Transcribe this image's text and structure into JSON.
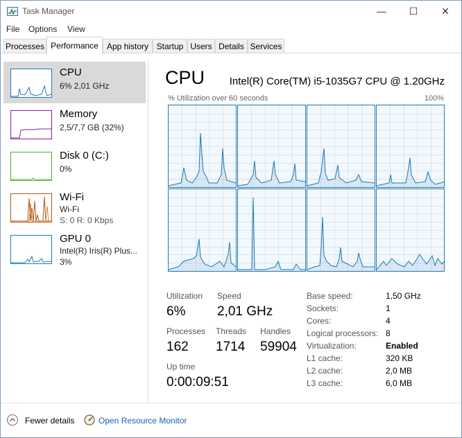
{
  "window": {
    "title": "Task Manager",
    "controls": {
      "minimize": "—",
      "maximize": "☐",
      "close": "✕"
    }
  },
  "menu": [
    "File",
    "Options",
    "View"
  ],
  "tabs": [
    {
      "label": "Processes",
      "active": false
    },
    {
      "label": "Performance",
      "active": true
    },
    {
      "label": "App history",
      "active": false
    },
    {
      "label": "Startup",
      "active": false
    },
    {
      "label": "Users",
      "active": false
    },
    {
      "label": "Details",
      "active": false
    },
    {
      "label": "Services",
      "active": false
    }
  ],
  "resources": [
    {
      "name": "CPU",
      "line1": "6% 2,01 GHz",
      "line2": "",
      "selected": true,
      "color": "#1f77b4"
    },
    {
      "name": "Memory",
      "line1": "2,5/7,7 GB (32%)",
      "line2": "",
      "selected": false,
      "color": "#8b1a9c"
    },
    {
      "name": "Disk 0 (C:)",
      "line1": "0%",
      "line2": "",
      "selected": false,
      "color": "#4caf20"
    },
    {
      "name": "Wi-Fi",
      "line1": "Wi-Fi",
      "line2": "S: 0 R: 0 Kbps",
      "selected": false,
      "color": "#b5530c"
    },
    {
      "name": "GPU 0",
      "line1": "Intel(R) Iris(R) Plus...",
      "line2": "3%",
      "selected": false,
      "color": "#1f77b4"
    }
  ],
  "cpu": {
    "heading": "CPU",
    "model": "Intel(R) Core(TM) i5-1035G7 CPU @ 1.20GHz",
    "graph_label": "% Utilization over 60 seconds",
    "graph_max": "100%",
    "core_count": 8
  },
  "stats": {
    "utilization": {
      "label": "Utilization",
      "value": "6%"
    },
    "speed": {
      "label": "Speed",
      "value": "2,01 GHz"
    },
    "processes": {
      "label": "Processes",
      "value": "162"
    },
    "threads": {
      "label": "Threads",
      "value": "1714"
    },
    "handles": {
      "label": "Handles",
      "value": "59904"
    },
    "uptime": {
      "label": "Up time",
      "value": "0:00:09:51"
    }
  },
  "specs": [
    {
      "label": "Base speed:",
      "value": "1,50 GHz",
      "bold": false
    },
    {
      "label": "Sockets:",
      "value": "1",
      "bold": false
    },
    {
      "label": "Cores:",
      "value": "4",
      "bold": false
    },
    {
      "label": "Logical processors:",
      "value": "8",
      "bold": false
    },
    {
      "label": "Virtualization:",
      "value": "Enabled",
      "bold": true
    },
    {
      "label": "L1 cache:",
      "value": "320 KB",
      "bold": false
    },
    {
      "label": "L2 cache:",
      "value": "2,0 MB",
      "bold": false
    },
    {
      "label": "L3 cache:",
      "value": "6,0 MB",
      "bold": false
    }
  ],
  "footer": {
    "fewer_details": "Fewer details",
    "open_resource_monitor": "Open Resource Monitor"
  },
  "colors": {
    "accent": "#1f77b4",
    "graph_fill": "#f3f8fc",
    "grid": "#d7e6f3",
    "link": "#1a5fb4"
  }
}
